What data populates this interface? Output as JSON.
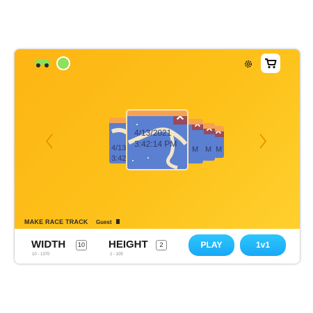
{
  "cards": {
    "main": {
      "date": "4/13/2021",
      "time": "3:42:14 PM",
      "close": "✕"
    },
    "back": {
      "date": "4/13",
      "time": "3:42"
    },
    "s1": {
      "tail": "M",
      "close": "✕"
    },
    "s2": {
      "tail": "M",
      "close": "✕"
    },
    "s3": {
      "tail": "M",
      "close": "✕"
    }
  },
  "footer": {
    "make_track": "MAKE RACE TRACK",
    "user": "Guest"
  },
  "controls": {
    "width_label": "WIDTH",
    "width_value": "10",
    "width_range": "10 - 1370",
    "height_label": "HEIGHT",
    "height_value": "2",
    "height_range": "1 - 105",
    "play": "PLAY",
    "versus": "1v1"
  },
  "colors": {
    "background": "#fdb514",
    "button": "#1aa8f5",
    "track_water": "#5b7fd1",
    "card_border": "#f6a253",
    "close": "#9b4a5a"
  },
  "icons": [
    "car-icon",
    "profile-icon",
    "gear-icon",
    "cart-icon",
    "chevron-left-icon",
    "chevron-right-icon",
    "flag-icon"
  ]
}
